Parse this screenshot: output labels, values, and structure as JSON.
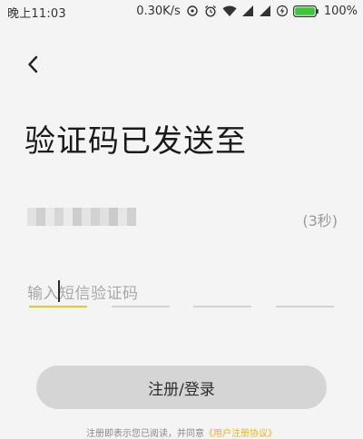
{
  "status_bar": {
    "time": "晚上11:03",
    "net_speed": "0.30K/s",
    "battery_percent": "100%",
    "icons": [
      "sync-icon",
      "alarm-icon",
      "wifi-icon",
      "signal-icon",
      "signal-icon",
      "charging-icon",
      "battery-icon"
    ]
  },
  "header": {
    "back_icon": "chevron-left-icon"
  },
  "main": {
    "title": "验证码已发送至",
    "phone_number_obscured": true,
    "countdown": "(3秒)",
    "code_input": {
      "placeholder": "输入短信验证码",
      "slots": 4,
      "active_slot": 0
    }
  },
  "actions": {
    "submit_label": "注册/登录"
  },
  "footer": {
    "agreement_text": "注册即表示您已阅读，并同意",
    "agreement_link": "《用户注册协议》"
  },
  "colors": {
    "background": "#f4f4f4",
    "accent": "#f1c232",
    "link": "#e6b422",
    "button_bg": "#d5d5d5",
    "battery": "#3fc43b"
  }
}
